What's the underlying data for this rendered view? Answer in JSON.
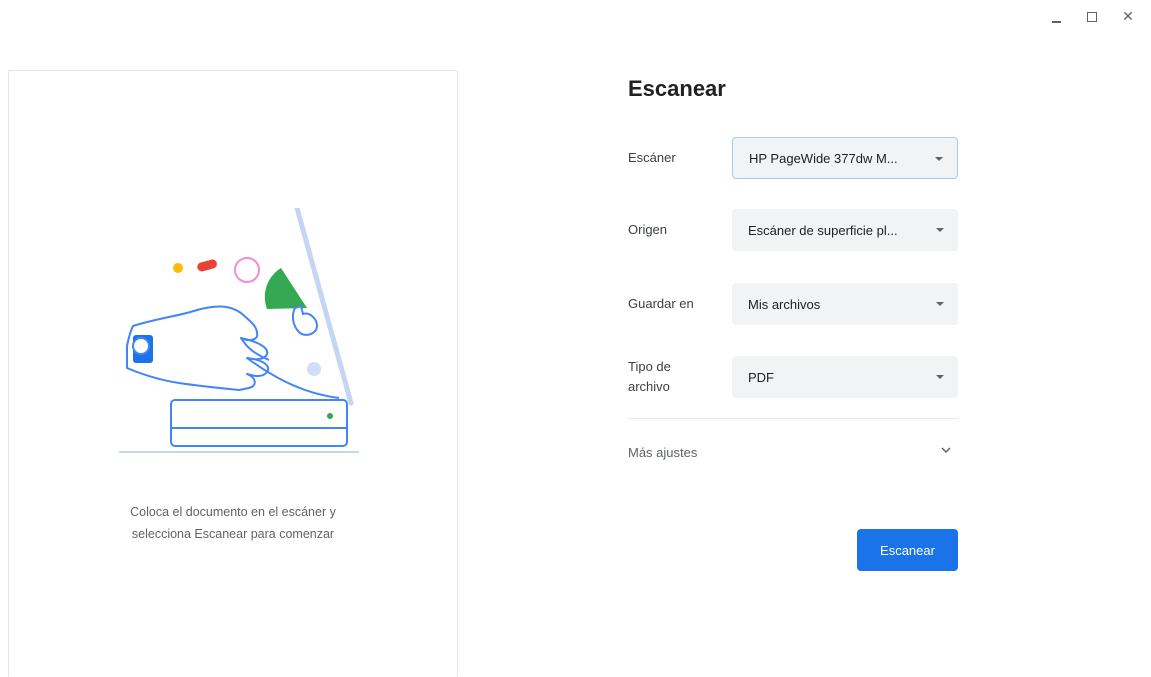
{
  "window": {
    "minimize_icon": "minimize-icon",
    "maximize_icon": "maximize-icon",
    "close_icon": "close-icon",
    "close_glyph": "✕"
  },
  "preview": {
    "illustration": "scanner-hand-illustration",
    "hint_line1": "Coloca el documento en el escáner y",
    "hint_line2": "selecciona Escanear para comenzar"
  },
  "panel": {
    "title": "Escanear",
    "fields": [
      {
        "label": "Escáner",
        "value": "HP PageWide 377dw M..."
      },
      {
        "label": "Origen",
        "value": "Escáner de superficie pl..."
      },
      {
        "label": "Guardar en",
        "value": "Mis archivos"
      },
      {
        "label_line1": "Tipo de",
        "label_line2": "archivo",
        "value": "PDF"
      }
    ],
    "more_settings": "Más ajustes",
    "scan_button": "Escanear"
  },
  "colors": {
    "accent": "#1a73e8",
    "field_bg": "#f1f3f4",
    "focus_border": "#a8c7fa"
  }
}
